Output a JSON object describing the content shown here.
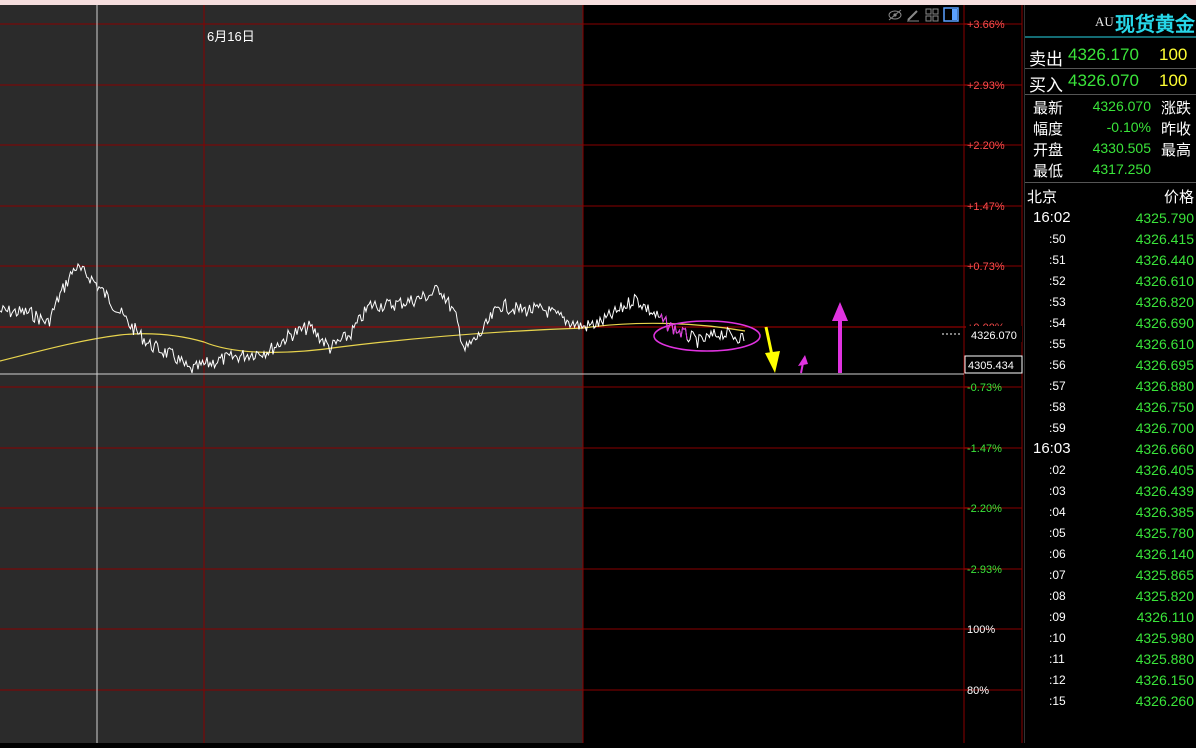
{
  "chart": {
    "date_label": "6月16日",
    "price_badge": "4326.070",
    "cursor_badge": "4305.434",
    "y_ticks": [
      "+3.66%",
      "+2.93%",
      "+2.20%",
      "+1.47%",
      "+0.73%",
      "+0.00%",
      "-0.73%",
      "-1.47%",
      "-2.20%",
      "-2.93%",
      "100%",
      "80%"
    ],
    "colors": {
      "grid": "#8a0000",
      "price_line": "#ffffff",
      "avg_line": "#e8d44d",
      "pos_tick": "#ff4d4d",
      "neg_tick": "#3ae43a",
      "highlight": "#e033e0"
    },
    "icons": [
      "eye-icon",
      "pencil-icon",
      "grid-icon",
      "panel-toggle-icon"
    ]
  },
  "panel": {
    "code": "AU",
    "name": "现货黄金",
    "sell_label": "卖出",
    "sell_price": "4326.170",
    "sell_qty": "100",
    "buy_label": "买入",
    "buy_price": "4326.070",
    "buy_qty": "100",
    "stats": {
      "latest_label": "最新",
      "latest": "4326.070",
      "change_label": "涨跌",
      "pct_label": "幅度",
      "pct": "-0.10%",
      "prev_close_label": "昨收",
      "open_label": "开盘",
      "open": "4330.505",
      "high_label": "最高",
      "low_label": "最低",
      "low": "4317.250"
    },
    "tick_header": {
      "time": "北京",
      "price": "价格"
    },
    "ticks": [
      {
        "time": "16:02",
        "price": "4325.790"
      },
      {
        "time": ":50",
        "price": "4326.415"
      },
      {
        "time": ":51",
        "price": "4326.440"
      },
      {
        "time": ":52",
        "price": "4326.610"
      },
      {
        "time": ":53",
        "price": "4326.820"
      },
      {
        "time": ":54",
        "price": "4326.690"
      },
      {
        "time": ":55",
        "price": "4326.610"
      },
      {
        "time": ":56",
        "price": "4326.695"
      },
      {
        "time": ":57",
        "price": "4326.880"
      },
      {
        "time": ":58",
        "price": "4326.750"
      },
      {
        "time": ":59",
        "price": "4326.700"
      },
      {
        "time": "16:03",
        "price": "4326.660"
      },
      {
        "time": ":02",
        "price": "4326.405"
      },
      {
        "time": ":03",
        "price": "4326.439"
      },
      {
        "time": ":04",
        "price": "4326.385"
      },
      {
        "time": ":05",
        "price": "4325.780"
      },
      {
        "time": ":06",
        "price": "4326.140"
      },
      {
        "time": ":07",
        "price": "4325.865"
      },
      {
        "time": ":08",
        "price": "4325.820"
      },
      {
        "time": ":09",
        "price": "4326.110"
      },
      {
        "time": ":10",
        "price": "4325.980"
      },
      {
        "time": ":11",
        "price": "4325.880"
      },
      {
        "time": ":12",
        "price": "4326.150"
      },
      {
        "time": ":15",
        "price": "4326.260"
      }
    ]
  }
}
